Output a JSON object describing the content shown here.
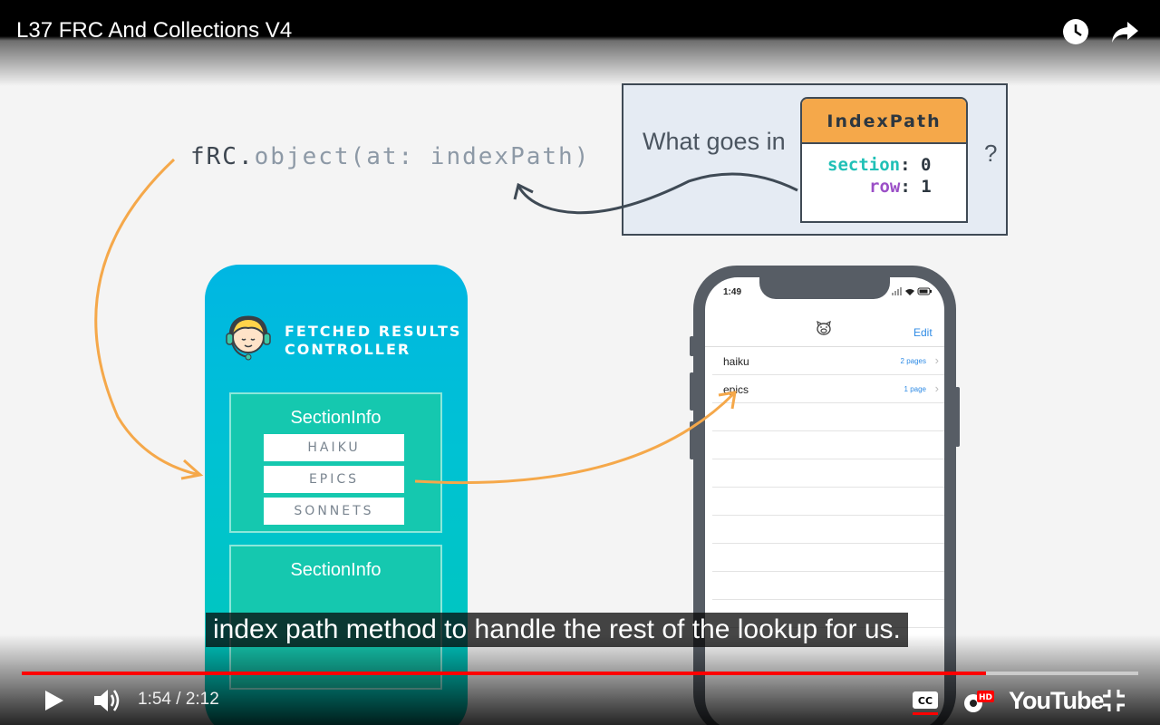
{
  "player": {
    "title": "L37 FRC And Collections V4",
    "time_current": "1:54",
    "time_total": "2:12",
    "time_display": "1:54 / 2:12",
    "progress_fraction": 0.8636,
    "caption": "index path method to handle the rest of the lookup for us.",
    "logo_text": "YouTube",
    "hd_badge": "HD",
    "cc_label": "CC",
    "icons": [
      "watch-later-icon",
      "share-icon",
      "play-icon",
      "volume-icon",
      "cc-icon",
      "settings-icon",
      "fullscreen-exit-icon"
    ],
    "colors": {
      "progress": "#ff0000",
      "cc_underline": "#ff0000"
    }
  },
  "slide": {
    "code": {
      "prefix": "fRC.",
      "rest": "object(at: indexPath)"
    },
    "question": {
      "text": "What goes in",
      "mark": "?",
      "card_title": "IndexPath",
      "section_key": "section",
      "section_value": "0",
      "row_key": "row",
      "row_value": "1"
    },
    "frc": {
      "title_line1": "FETCHED RESULTS",
      "title_line2": "CONTROLLER",
      "section_label": "SectionInfo",
      "rows": [
        "HAIKU",
        "EPICS",
        "SONNETS"
      ],
      "section2_label": "SectionInfo"
    },
    "phone": {
      "time": "1:49",
      "edit": "Edit",
      "rows": [
        {
          "title": "haiku",
          "detail": "2 pages"
        },
        {
          "title": "epics",
          "detail": "1 page"
        }
      ]
    }
  }
}
